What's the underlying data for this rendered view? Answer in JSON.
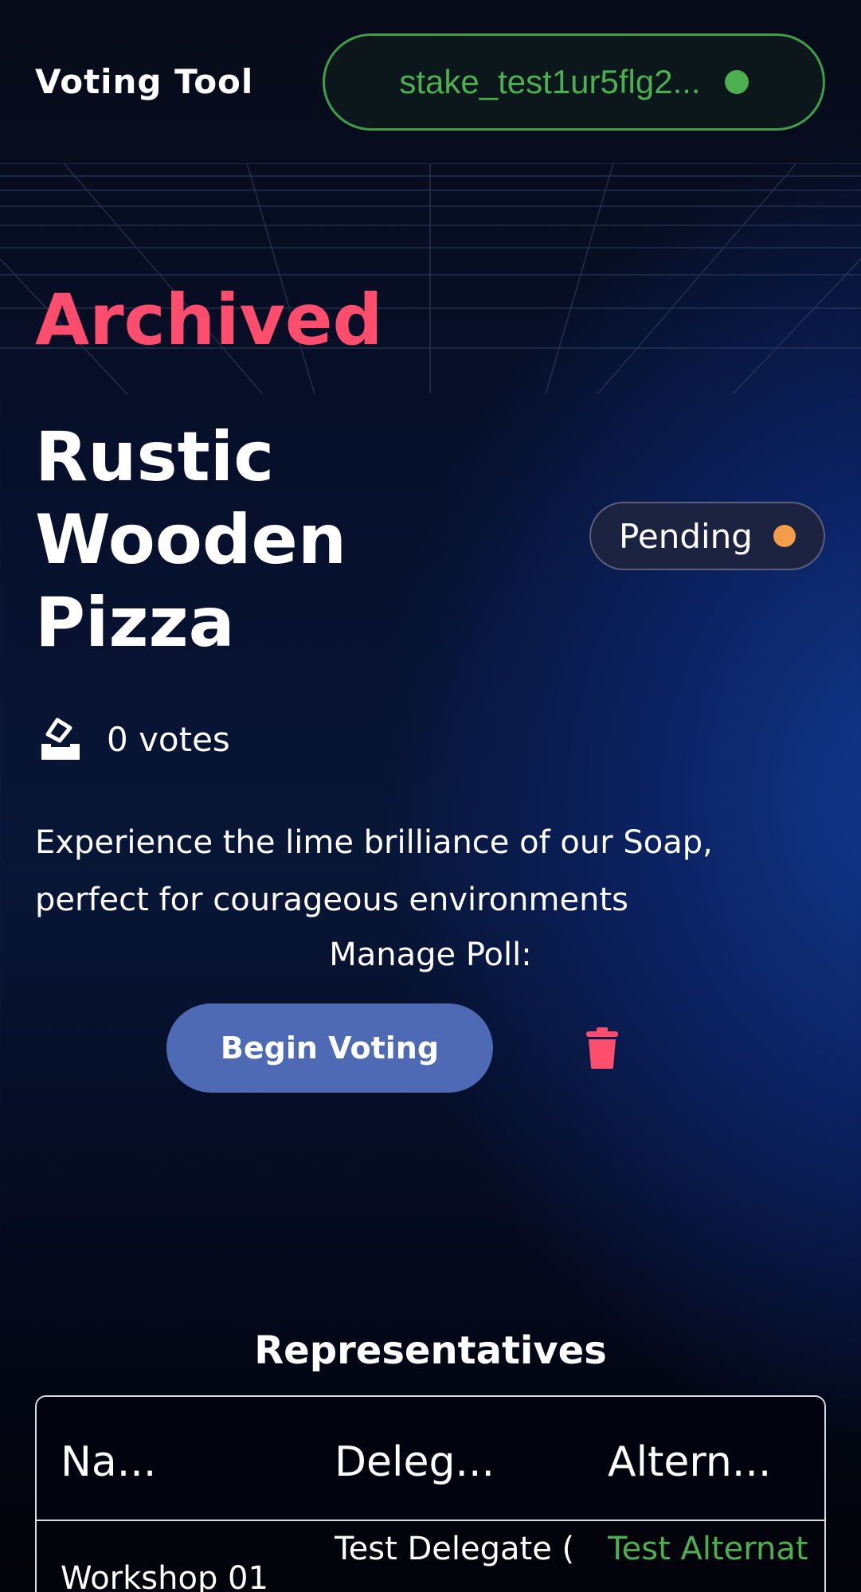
{
  "header": {
    "app_title": "Voting Tool",
    "wallet_address": "stake_test1ur5flg2...",
    "wallet_status_color": "#4caf50"
  },
  "poll": {
    "archived_label": "Archived",
    "title": "Rustic Wooden Pizza",
    "status": "Pending",
    "status_color": "#f39c4a",
    "votes_label": "0 votes",
    "description": "Experience the lime brilliance of our Soap, perfect for courageous environments",
    "manage_label": "Manage Poll:",
    "begin_button_label": "Begin Voting",
    "delete_icon": "trash-icon"
  },
  "representatives": {
    "heading": "Representatives",
    "columns": [
      "Na...",
      "Deleg...",
      "Altern..."
    ],
    "rows": [
      {
        "name": "Workshop 01",
        "delegate": "Test Delegate (",
        "alternate": "Test Alternat"
      }
    ]
  },
  "colors": {
    "accent_red": "#ff4d6d",
    "button_blue": "#4e6ab5",
    "link_green": "#4caf50"
  }
}
